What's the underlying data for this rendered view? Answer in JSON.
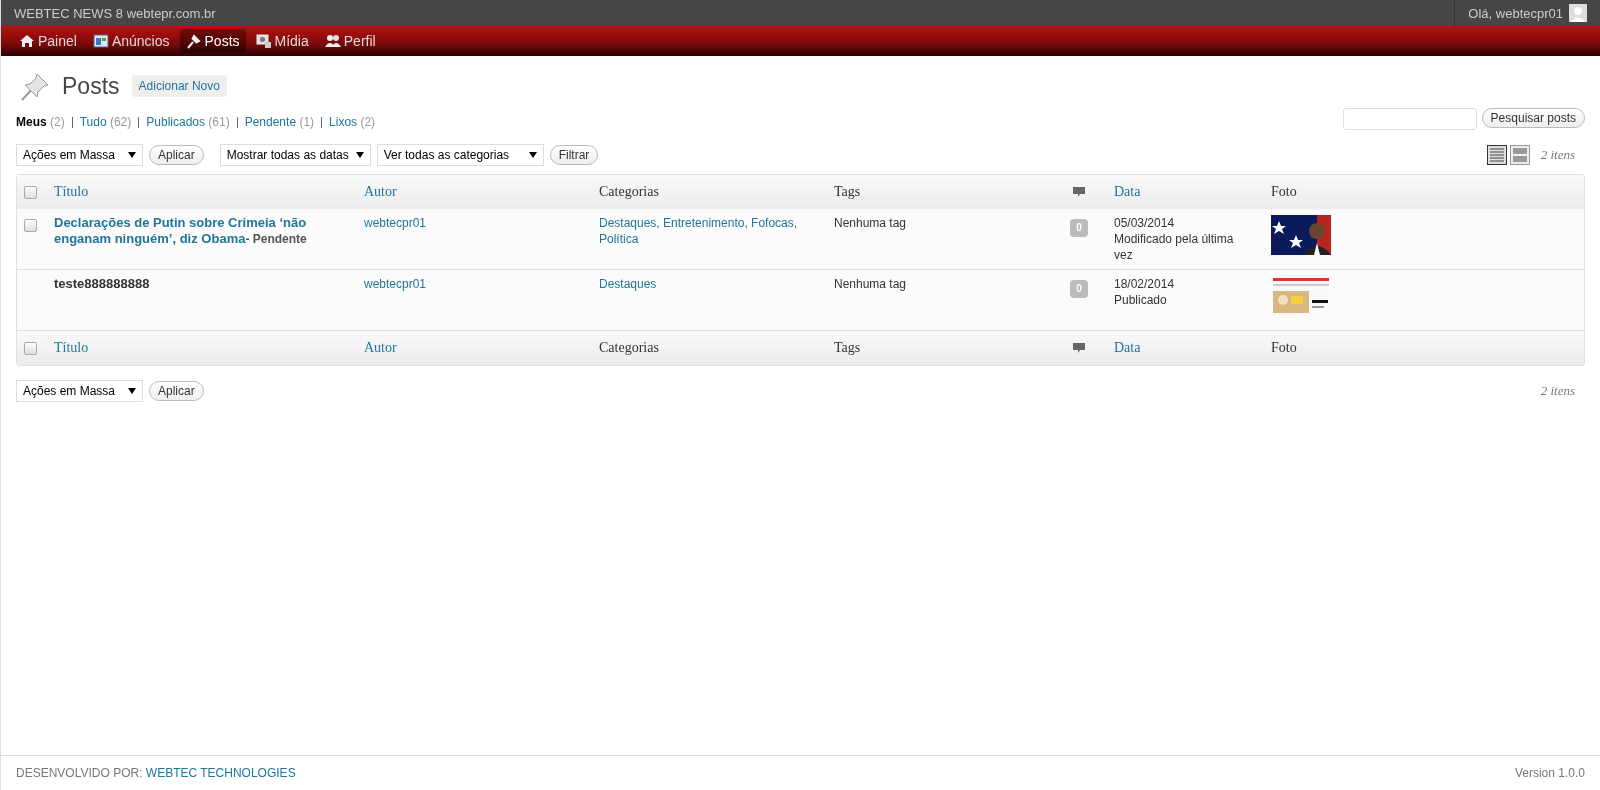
{
  "top_bar": {
    "site": "WEBTEC NEWS 8 webtepr.com.br",
    "greeting": "Olá, webtecpr01"
  },
  "nav": [
    {
      "label": "Painel",
      "kind": "home",
      "selected": false
    },
    {
      "label": "Anúncios",
      "kind": "ads",
      "selected": false
    },
    {
      "label": "Posts",
      "kind": "pin",
      "selected": true
    },
    {
      "label": "Mídia",
      "kind": "media",
      "selected": false
    },
    {
      "label": "Perfil",
      "kind": "users",
      "selected": false
    }
  ],
  "page": {
    "title": "Posts",
    "add_button": "Adicionar Novo"
  },
  "filters": [
    {
      "label": "Meus",
      "count": "(2)",
      "selected": true
    },
    {
      "label": "Tudo",
      "count": "(62)",
      "selected": false
    },
    {
      "label": "Publicados",
      "count": "(61)",
      "selected": false
    },
    {
      "label": "Pendente",
      "count": "(1)",
      "selected": false
    },
    {
      "label": "Lixos",
      "count": "(2)",
      "selected": false
    }
  ],
  "search": {
    "button": "Pesquisar posts"
  },
  "toolbar": {
    "bulk_action": "Ações em Massa",
    "apply": "Aplicar",
    "dates": "Mostrar todas as datas",
    "categories": "Ver todas as categorias",
    "filter": "Filtrar",
    "count": "2 itens",
    "views": [
      {
        "kind": "list",
        "selected": true
      },
      {
        "kind": "excerpt",
        "selected": false
      }
    ]
  },
  "table": {
    "select_all_checked": false,
    "columns": [
      {
        "label": "Título",
        "kind": "text",
        "sortable": true
      },
      {
        "label": "Autor",
        "kind": "text",
        "sortable": true
      },
      {
        "label": "Categorias",
        "kind": "text",
        "sortable": false
      },
      {
        "label": "Tags",
        "kind": "text",
        "sortable": false
      },
      {
        "kind": "comments"
      },
      {
        "label": "Data",
        "kind": "text",
        "sortable": true
      },
      {
        "label": "Foto",
        "kind": "text",
        "sortable": false
      }
    ],
    "footer_select_all_checked": false,
    "footer_columns": [
      {
        "label": "Título",
        "kind": "text",
        "sortable": true
      },
      {
        "label": "Autor",
        "kind": "text",
        "sortable": true
      },
      {
        "label": "Categorias",
        "kind": "text",
        "sortable": false
      },
      {
        "label": "Tags",
        "kind": "text",
        "sortable": false
      },
      {
        "kind": "comments"
      },
      {
        "label": "Data",
        "kind": "text",
        "sortable": true
      },
      {
        "label": "Foto",
        "kind": "text",
        "sortable": false
      }
    ],
    "rows": [
      {
        "title": "Declarações de Putin sobre Crimeia ‘não enganam ninguém’, diz Obama",
        "linked": true,
        "status": "- Pendente",
        "selectable": true,
        "checked": false,
        "author": "webtecpr01",
        "categories": "Destaques, Entretenimento, Fofocas, Política",
        "tags": "Nenhuma tag",
        "comments": "0",
        "date": "05/03/2014",
        "date_note": "Modificado pela última vez"
      },
      {
        "title": "teste888888888",
        "linked": false,
        "selectable": false,
        "author": "webtecpr01",
        "categories": "Destaques",
        "tags": "Nenhuma tag",
        "comments": "0",
        "date": "18/02/2014",
        "date_note": "Publicado"
      }
    ]
  },
  "bottom_toolbar": {
    "bulk_action": "Ações em Massa",
    "apply": "Aplicar",
    "count": "2 itens"
  },
  "footer": {
    "credit": "DESENVOLVIDO POR:",
    "link": "WEBTEC TECHNOLOGIES",
    "version": "Version 1.0.0"
  }
}
